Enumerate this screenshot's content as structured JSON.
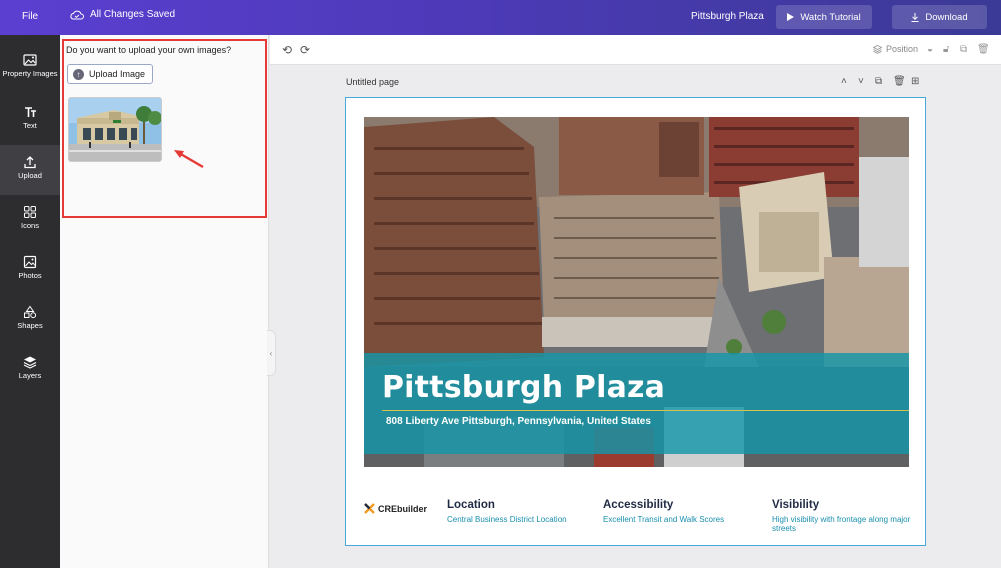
{
  "topbar": {
    "file_label": "File",
    "saved_label": "All Changes Saved",
    "project_title": "Pittsburgh Plaza",
    "watch_label": "Watch Tutorial",
    "download_label": "Download"
  },
  "rail": {
    "items": [
      {
        "label": "Property Images",
        "icon": "image-icon"
      },
      {
        "label": "Text",
        "icon": "text-icon"
      },
      {
        "label": "Upload",
        "icon": "upload-icon"
      },
      {
        "label": "Icons",
        "icon": "grid-icon"
      },
      {
        "label": "Photos",
        "icon": "photo-icon"
      },
      {
        "label": "Shapes",
        "icon": "shapes-icon"
      },
      {
        "label": "Layers",
        "icon": "layers-icon"
      }
    ],
    "active": "Upload"
  },
  "panel": {
    "question": "Do you want to upload your own images?",
    "upload_label": "Upload Image"
  },
  "toolbar": {
    "position_label": "Position"
  },
  "canvas": {
    "page_label": "Untitled page",
    "title": "Pittsburgh Plaza",
    "address": "808 Liberty Ave Pittsburgh, Pennsylvania, United States",
    "brand": "CREbuilder",
    "features": [
      {
        "title": "Location",
        "desc": "Central Business District Location"
      },
      {
        "title": "Accessibility",
        "desc": "Excellent Transit and Walk Scores"
      },
      {
        "title": "Visibility",
        "desc": "High visibility with frontage along major streets"
      }
    ]
  },
  "colors": {
    "accent": "#5b3fd1",
    "teal_band": "#1496a8",
    "highlight": "#e53935"
  }
}
